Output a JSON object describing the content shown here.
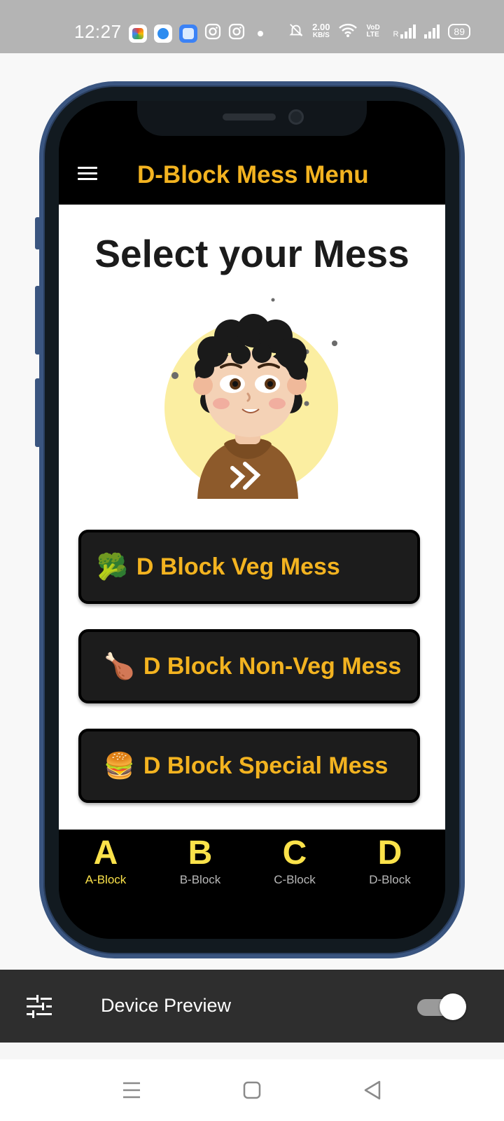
{
  "status_bar": {
    "time": "12:27",
    "speed_value": "2.00",
    "speed_unit": "KB/S",
    "network_label": "VoD LTE",
    "roaming": "R",
    "battery": "89"
  },
  "app": {
    "title": "D-Block Mess Menu",
    "heading": "Select your Mess",
    "accent_color": "#f3b320"
  },
  "mess_options": [
    {
      "emoji": "🥦",
      "label": "D Block Veg Mess"
    },
    {
      "emoji": "🍗",
      "label": "D Block Non-Veg Mess"
    },
    {
      "emoji": "🍔",
      "label": "D Block Special Mess"
    }
  ],
  "bottom_nav": [
    {
      "letter": "A",
      "label": "A-Block",
      "active": true
    },
    {
      "letter": "B",
      "label": "B-Block",
      "active": false
    },
    {
      "letter": "C",
      "label": "C-Block",
      "active": false
    },
    {
      "letter": "D",
      "label": "D-Block",
      "active": false
    }
  ],
  "device_preview": {
    "label": "Device Preview",
    "enabled": true
  }
}
